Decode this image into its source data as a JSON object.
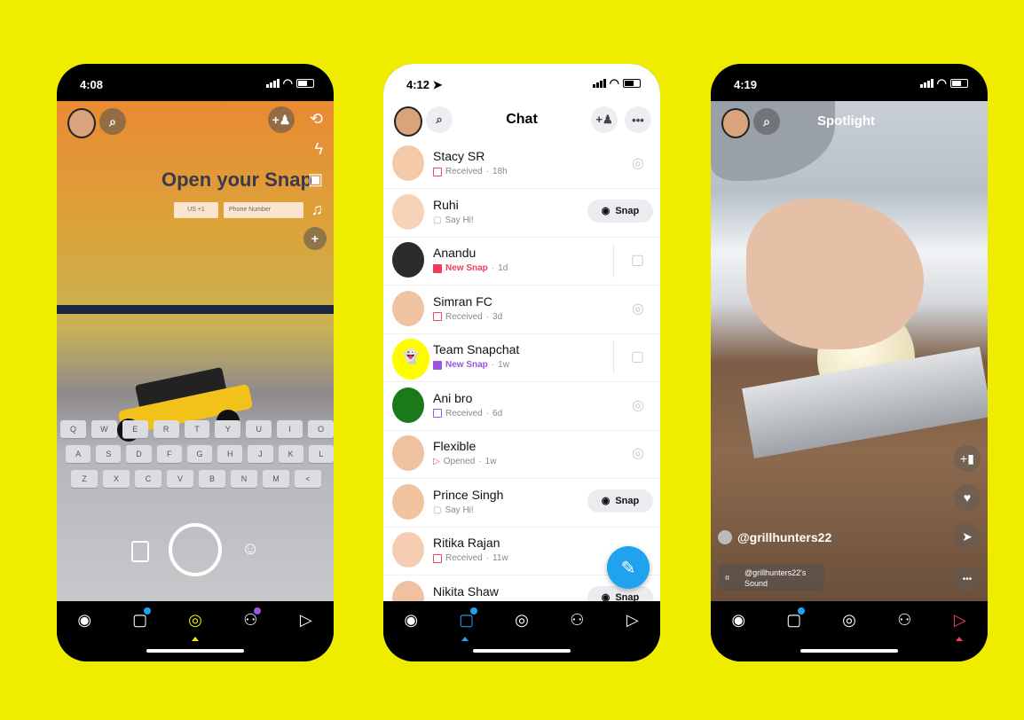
{
  "colors": {
    "background": "#F0EC00",
    "chat_blue": "#1fa3ee",
    "received_red": "#e84b5a",
    "new_snap_red": "#f23c57",
    "new_snap_purple": "#9b55e0",
    "spotlight_active": "#f0405a"
  },
  "phone1": {
    "time": "4:08",
    "camera_text": "Open your Snap",
    "country_code": "US +1",
    "phone_placeholder": "Phone Number",
    "nav": [
      "map-icon",
      "chat-icon",
      "camera-icon",
      "friends-icon",
      "play-icon"
    ]
  },
  "phone2": {
    "time": "4:12",
    "title": "Chat",
    "snap_label": "Snap",
    "chats": [
      {
        "name": "Stacy SR",
        "status": "Received",
        "time": "18h",
        "kind": "received",
        "action": "camera"
      },
      {
        "name": "Ruhi",
        "status": "Say Hi!",
        "time": "",
        "kind": "sayhi",
        "action": "snap"
      },
      {
        "name": "Anandu",
        "status": "New Snap",
        "time": "1d",
        "kind": "newsnap-red",
        "action": "chat"
      },
      {
        "name": "Simran FC",
        "status": "Received",
        "time": "3d",
        "kind": "received",
        "action": "camera"
      },
      {
        "name": "Team Snapchat",
        "status": "New Snap",
        "time": "1w",
        "kind": "newsnap-purple",
        "action": "chat"
      },
      {
        "name": "Ani bro",
        "status": "Received",
        "time": "6d",
        "kind": "received-purple",
        "action": "camera"
      },
      {
        "name": "Flexible",
        "status": "Opened",
        "time": "1w",
        "kind": "opened",
        "action": "camera"
      },
      {
        "name": "Prince Singh",
        "status": "Say Hi!",
        "time": "",
        "kind": "sayhi",
        "action": "snap"
      },
      {
        "name": "Ritika Rajan",
        "status": "Received",
        "time": "11w",
        "kind": "received",
        "action": "none"
      },
      {
        "name": "Nikita Shaw",
        "status": "",
        "time": "",
        "kind": "partial",
        "action": "snap"
      }
    ]
  },
  "phone3": {
    "time": "4:19",
    "title": "Spotlight",
    "username": "@grillhunters22",
    "sound_line1": "@grillhunters22's",
    "sound_line2": "Sound"
  }
}
